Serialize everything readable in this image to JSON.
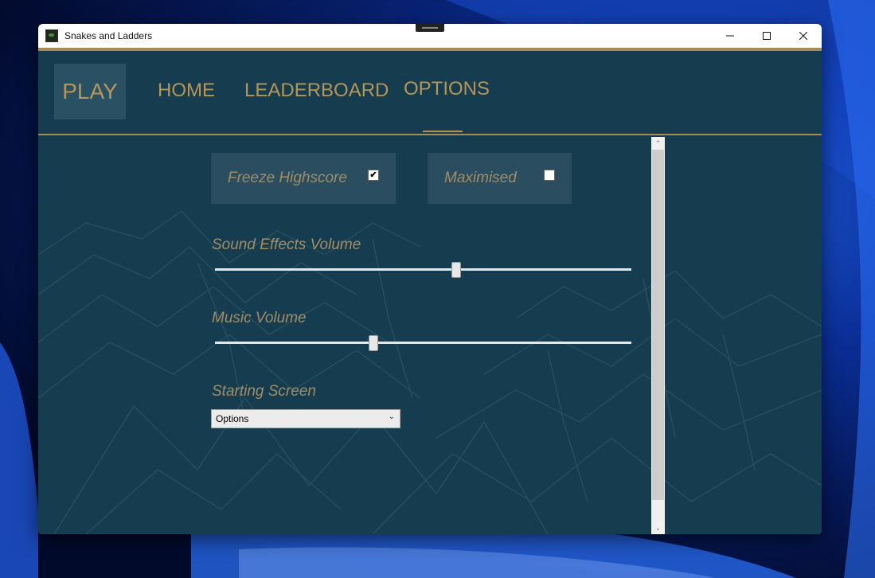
{
  "window": {
    "title": "Snakes and Ladders"
  },
  "titlebar": {
    "minimize": "—",
    "maximize": "☐",
    "close": "✕"
  },
  "nav": {
    "play": "PLAY",
    "home": "HOME",
    "leaderboard": "LEADERBOARD",
    "options": "OPTIONS",
    "active": "OPTIONS"
  },
  "options": {
    "freeze_highscore": {
      "label": "Freeze Highscore",
      "checked": true,
      "mark": "✔"
    },
    "maximised": {
      "label": "Maximised",
      "checked": false,
      "mark": ""
    },
    "sound_effects_volume": {
      "label": "Sound Effects Volume",
      "value": 0.58
    },
    "music_volume": {
      "label": "Music Volume",
      "value": 0.38
    },
    "starting_screen": {
      "label": "Starting Screen",
      "selected": "Options"
    }
  },
  "colors": {
    "background": "#163d4f",
    "accent_gold": "#b69657",
    "label_gold": "#a08d66",
    "panel": "#2a4e5f"
  },
  "icons": {
    "app": "snake-ladder-app-icon",
    "dropdown": "chevron-down-icon",
    "scroll_up": "chevron-up-icon",
    "scroll_down": "chevron-down-icon"
  }
}
